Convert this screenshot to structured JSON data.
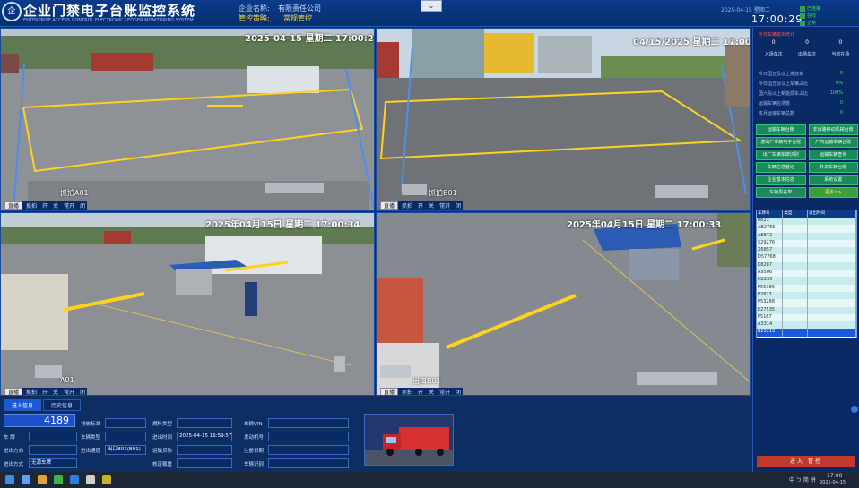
{
  "header": {
    "logo_text": "企",
    "title": "企业门禁电子台账监控系统",
    "subtitle": "ENTERPRISE ACCESS CONTROL ELECTRONIC LEDGER MONITORING SYSTEM",
    "company_label": "企业名称:",
    "company_name": "有限责任公司",
    "mode_label": "管控策略:",
    "mode_value": "常规管控",
    "dropdown_icon": "⌄",
    "date": "2025-04-15  星期二",
    "clock": "17:00:29",
    "status": [
      "已连接",
      "在线",
      "正常"
    ]
  },
  "cameras": [
    {
      "osd": "2025-04-15 星期二 17:00:29",
      "label": "抓拍A01",
      "tag": "直播",
      "buttons": [
        "抓拍",
        "开",
        "关",
        "常开",
        "闭"
      ]
    },
    {
      "osd": "04/15/2025 星期二 17:00:35",
      "label": "抓拍B01",
      "tag": "直播",
      "buttons": [
        "抓拍",
        "开",
        "关",
        "常开",
        "闭"
      ]
    },
    {
      "osd": "2025年04月15日 星期二 17:00:34",
      "label": "A01",
      "tag": "直播",
      "buttons": [
        "抓拍",
        "开",
        "关",
        "常开",
        "闭"
      ]
    },
    {
      "osd": "2025年04月15日 星期二 17:00:33",
      "label": "出口B01",
      "tag": "直播",
      "buttons": [
        "抓拍",
        "开",
        "关",
        "常开",
        "闭"
      ]
    }
  ],
  "stats": {
    "head": "今日车辆进出统计",
    "counts": [
      {
        "value": "0",
        "label": "入场车次"
      },
      {
        "value": "0",
        "label": "出场车次"
      },
      {
        "value": "0",
        "label": "当前在场"
      }
    ],
    "rows": [
      {
        "label": "今日国五及以上排放车",
        "value": "0"
      },
      {
        "label": "今日国五及以上车辆占比",
        "value": "0%"
      },
      {
        "label": "国六及以上新能源车占比",
        "value": "100%"
      },
      {
        "label": "运输车辆在场数",
        "value": "0"
      },
      {
        "label": "本月运输车辆总数",
        "value": "0"
      }
    ]
  },
  "buttons": [
    "运输车辆台账",
    "非道路移动机械台账",
    "进出厂车辆电子台账",
    "厂内运输车辆台账",
    "出厂车辆车牌识别",
    "运输车辆查询",
    "车辆信息登记",
    "外来车辆台账",
    "企业基本信息",
    "系统设置",
    "车辆黑名单",
    "更多>>"
  ],
  "plate_table": {
    "headers": [
      "车牌号",
      "类型",
      "进出时间"
    ],
    "rows": [
      [
        "0823",
        "",
        ""
      ],
      [
        "AB2765",
        "",
        ""
      ],
      [
        "A8872",
        "",
        ""
      ],
      [
        "529276",
        "",
        ""
      ],
      [
        "X6857",
        "",
        ""
      ],
      [
        "D57768",
        "",
        ""
      ],
      [
        "K8287",
        "",
        ""
      ],
      [
        "A9506",
        "",
        ""
      ],
      [
        "H2255",
        "",
        ""
      ],
      [
        "P55386",
        "",
        ""
      ],
      [
        "P2827",
        "",
        ""
      ],
      [
        "P53288",
        "",
        ""
      ],
      [
        "E27535",
        "",
        ""
      ],
      [
        "P5167",
        "",
        ""
      ],
      [
        "A3314",
        "",
        ""
      ],
      [
        "B25215",
        "",
        ""
      ]
    ]
  },
  "red_button": "进入 管控",
  "bottom": {
    "tabs": [
      "进入信息",
      "历史信息"
    ],
    "plate": "4189",
    "fields": [
      {
        "label": "车   牌",
        "value": ""
      },
      {
        "label": "进出方向",
        "value": ""
      },
      {
        "label": "进出方式",
        "value": "无源车牌"
      },
      {
        "label": "排放标准",
        "value": ""
      },
      {
        "label": "车辆类型",
        "value": ""
      },
      {
        "label": "进出通道",
        "value": "出口B01(B01)"
      },
      {
        "label": "燃料类型",
        "value": ""
      },
      {
        "label": "进出时间",
        "value": "2025-04-15 16:59:57"
      },
      {
        "label": "运输货物",
        "value": ""
      },
      {
        "label": "核定载重",
        "value": ""
      },
      {
        "label": "车辆VIN",
        "value": ""
      },
      {
        "label": "发动机号",
        "value": ""
      },
      {
        "label": "注册日期",
        "value": ""
      },
      {
        "label": "车辆识别",
        "value": ""
      },
      {
        "label": "车辆品牌",
        "value": ""
      }
    ]
  },
  "taskbar": {
    "time": "17:00",
    "date": "2025-04-15",
    "tray": "中 ㄅ 简 拼"
  }
}
